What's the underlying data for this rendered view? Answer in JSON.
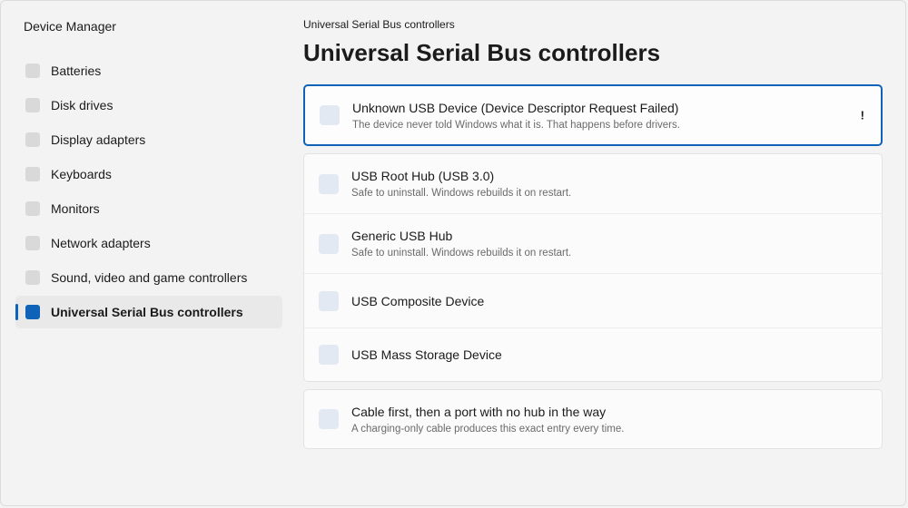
{
  "app": {
    "title": "Device Manager"
  },
  "sidebar": {
    "items": [
      {
        "label": "Batteries",
        "active": false
      },
      {
        "label": "Disk drives",
        "active": false
      },
      {
        "label": "Display adapters",
        "active": false
      },
      {
        "label": "Keyboards",
        "active": false
      },
      {
        "label": "Monitors",
        "active": false
      },
      {
        "label": "Network adapters",
        "active": false
      },
      {
        "label": "Sound, video and game controllers",
        "active": false
      },
      {
        "label": "Universal Serial Bus controllers",
        "active": true
      }
    ]
  },
  "main": {
    "breadcrumb": "Universal Serial Bus controllers",
    "title": "Universal Serial Bus controllers",
    "problem_device": {
      "title": "Unknown USB Device (Device Descriptor Request Failed)",
      "subtitle": "The device never told Windows what it is. That happens before drivers.",
      "status_glyph": "!"
    },
    "devices": [
      {
        "title": "USB Root Hub (USB 3.0)",
        "subtitle": "Safe to uninstall. Windows rebuilds it on restart."
      },
      {
        "title": "Generic USB Hub",
        "subtitle": "Safe to uninstall. Windows rebuilds it on restart."
      },
      {
        "title": "USB Composite Device"
      },
      {
        "title": "USB Mass Storage Device"
      }
    ],
    "tip": {
      "title": "Cable first, then a port with no hub in the way",
      "subtitle": "A charging-only cable produces this exact entry every time."
    }
  },
  "colors": {
    "accent": "#0e63b8",
    "device_icon": "#e3e9f2"
  }
}
